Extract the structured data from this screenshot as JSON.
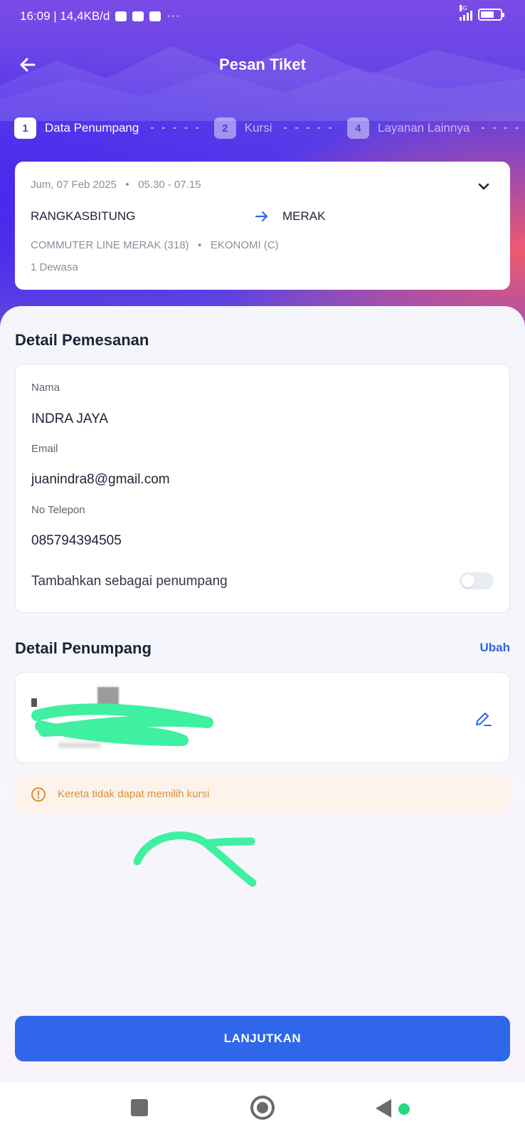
{
  "status_bar": {
    "time_speed": "16:09 | 14,4KB/d",
    "more": "···",
    "network": "4G",
    "battery_level": 0.7
  },
  "header": {
    "title": "Pesan Tiket",
    "back_icon": "arrow-left-icon"
  },
  "steps": [
    {
      "num": "1",
      "label": "Data Penumpang",
      "active": true
    },
    {
      "num": "2",
      "label": "Kursi",
      "active": false
    },
    {
      "num": "4",
      "label": "Layanan Lainnya",
      "active": false
    }
  ],
  "steps_dash": "- - - - -",
  "trip": {
    "date": "Jum, 07 Feb 2025",
    "time": "05.30 - 07.15",
    "from": "RANGKASBITUNG",
    "to": "MERAK",
    "train": "COMMUTER LINE MERAK (318)",
    "class": "EKONOMI (C)",
    "passengers": "1 Dewasa"
  },
  "order_detail": {
    "title": "Detail Pemesanan",
    "name_label": "Nama",
    "name_value": "INDRA JAYA",
    "email_label": "Email",
    "email_value": "juanindra8@gmail.com",
    "phone_label": "No Telepon",
    "phone_value": "085794394505",
    "add_passenger_label": "Tambahkan sebagai penumpang",
    "add_passenger_on": false
  },
  "passenger_detail": {
    "title": "Detail Penumpang",
    "edit_link": "Ubah",
    "edit_icon": "pencil-icon"
  },
  "warning": {
    "text": "Kereta tidak dapat memilih kursi",
    "icon": "alert-circle-icon"
  },
  "cta": {
    "label": "LANJUTKAN"
  },
  "nav": {
    "recents_icon": "square-icon",
    "home_icon": "circle-icon",
    "back_icon": "triangle-back-icon"
  },
  "colors": {
    "primary": "#2f66ea",
    "warning_text": "#d9903f",
    "warning_bg": "#fdf3ea",
    "scribble": "#3ff0a0"
  }
}
